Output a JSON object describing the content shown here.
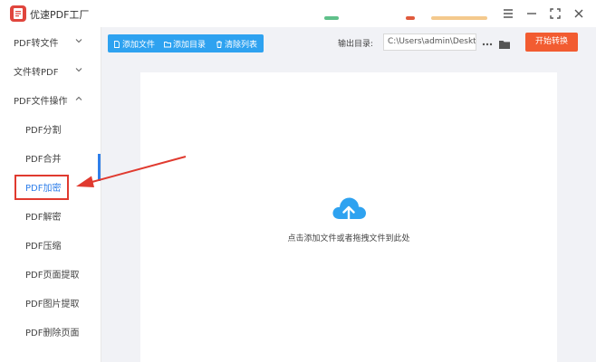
{
  "app": {
    "title": "优速PDF工厂"
  },
  "colors": {
    "accent_blue": "#2ea2f0",
    "start_orange": "#f25c31",
    "highlight_red": "#e03a2f",
    "active_indicator": "#2f7fea"
  },
  "sidebar": {
    "items": [
      {
        "label": "PDF转文件",
        "type": "group",
        "expanded": false
      },
      {
        "label": "文件转PDF",
        "type": "group",
        "expanded": false
      },
      {
        "label": "PDF文件操作",
        "type": "group",
        "expanded": true
      },
      {
        "label": "PDF分割",
        "type": "sub"
      },
      {
        "label": "PDF合并",
        "type": "sub"
      },
      {
        "label": "PDF加密",
        "type": "sub",
        "selected": true
      },
      {
        "label": "PDF解密",
        "type": "sub"
      },
      {
        "label": "PDF压缩",
        "type": "sub"
      },
      {
        "label": "PDF页面提取",
        "type": "sub"
      },
      {
        "label": "PDF图片提取",
        "type": "sub"
      },
      {
        "label": "PDF删除页面",
        "type": "sub"
      }
    ]
  },
  "toolbar": {
    "add_file": "添加文件",
    "add_folder": "添加目录",
    "clear_list": "清除列表",
    "output_label": "输出目录:",
    "output_path": "C:\\Users\\admin\\Deskto",
    "more_icon": "more-icon",
    "folder_icon": "folder-icon",
    "start_button": "开始转换"
  },
  "drop_area": {
    "hint": "点击添加文件或者拖拽文件到此处",
    "icon": "upload-cloud-icon"
  },
  "window_controls": {
    "menu_icon": "menu-icon",
    "minimize_icon": "minimize-icon",
    "maximize_icon": "maximize-icon",
    "close_icon": "close-icon"
  }
}
